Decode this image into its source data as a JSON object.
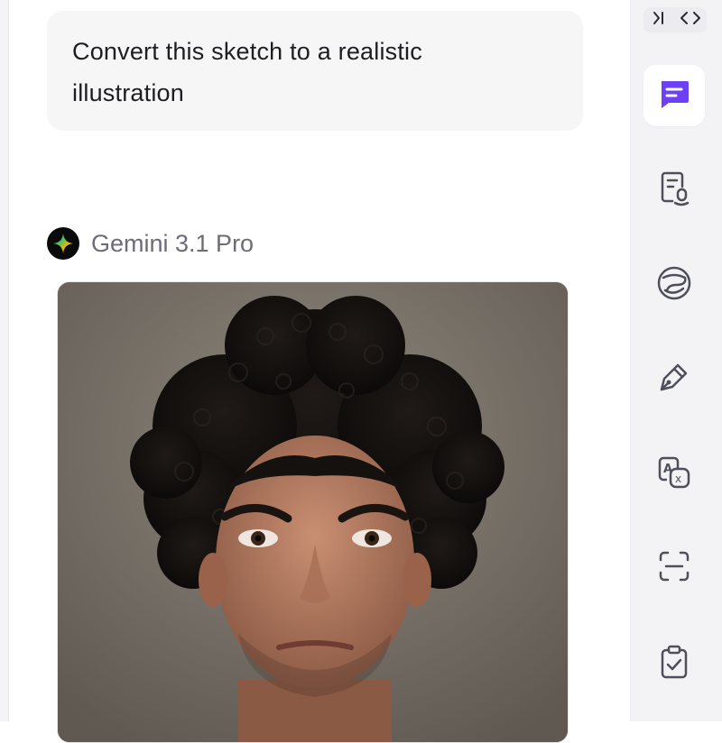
{
  "chat": {
    "user_message": "Convert this sketch to a realistic illustration",
    "user_message_line1": "Convert this sketch to a realistic",
    "user_message_line2": "illustration",
    "model_name": "Gemini 3.1 Pro",
    "image_alt": "Realistic portrait of a man with curly dark hair"
  },
  "sidebar": {
    "items": [
      {
        "icon": "chat-icon",
        "active": true
      },
      {
        "icon": "document-search-icon",
        "active": false
      },
      {
        "icon": "globe-chat-icon",
        "active": false
      },
      {
        "icon": "pen-icon",
        "active": false
      },
      {
        "icon": "translate-icon",
        "active": false
      },
      {
        "icon": "scan-text-icon",
        "active": false
      },
      {
        "icon": "clipboard-check-icon",
        "active": false
      }
    ]
  },
  "colors": {
    "accent": "#6d3ff5",
    "icon_stroke": "#4f4f5b",
    "bubble_bg": "#f6f6f7",
    "sidebar_bg": "#f3f3f6"
  }
}
